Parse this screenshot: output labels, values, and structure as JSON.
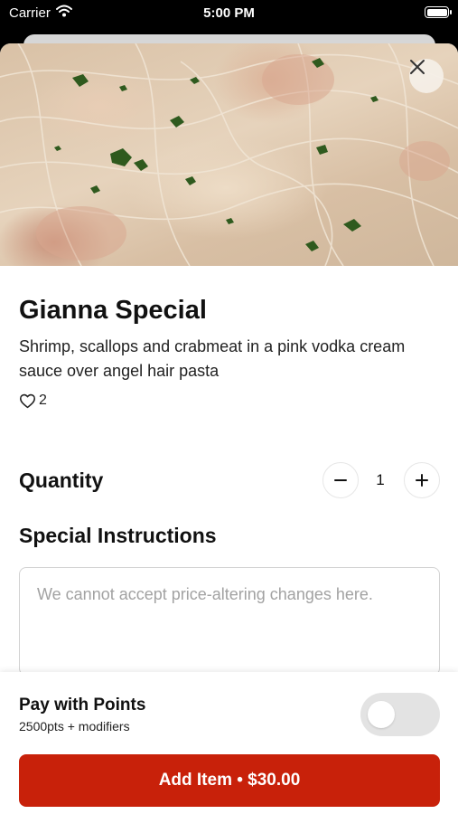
{
  "status_bar": {
    "carrier": "Carrier",
    "time": "5:00 PM"
  },
  "item": {
    "title": "Gianna Special",
    "description": "Shrimp, scallops and crabmeat in a pink vodka cream sauce over angel hair pasta",
    "likes_count": "2",
    "image_icon": "food-photo"
  },
  "quantity": {
    "label": "Quantity",
    "value": "1",
    "minus_symbol": "−",
    "plus_symbol": "+"
  },
  "special_instructions": {
    "label": "Special Instructions",
    "placeholder": "We cannot accept price-altering changes here.",
    "value": ""
  },
  "points": {
    "title": "Pay with Points",
    "subtitle": "2500pts + modifiers",
    "enabled": false
  },
  "add_button": {
    "label": "Add Item • $30.00"
  },
  "colors": {
    "accent": "#c8210a",
    "toggle_off": "#e3e3e3",
    "text": "#111111"
  }
}
